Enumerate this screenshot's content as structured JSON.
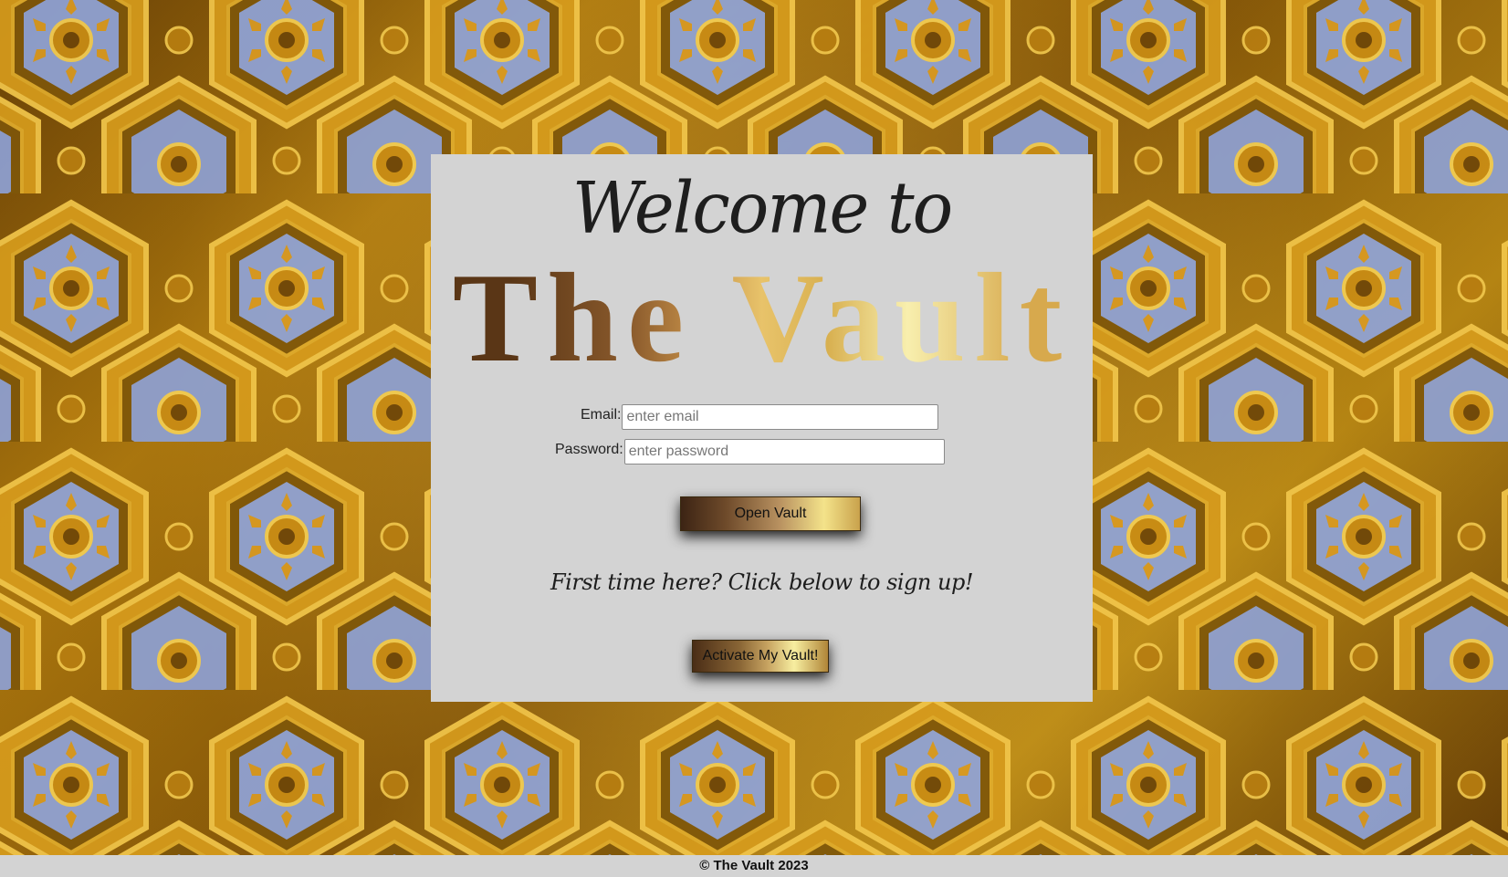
{
  "background": {
    "icon": "ornate-gold-ceiling-pattern",
    "colors": {
      "gold": "#c8941a",
      "dark_gold": "#6b4306",
      "blue": "#8fa3d8"
    }
  },
  "panel": {
    "background_color": "#d3d3d3",
    "welcome_text": "Welcome to",
    "title": "The Vault"
  },
  "login_form": {
    "email_label": "Email:",
    "email_placeholder": "enter email",
    "email_value": "",
    "password_label": "Password:",
    "password_placeholder": "enter password",
    "password_value": "",
    "submit_label": "Open Vault"
  },
  "signup": {
    "prompt": "First time here? Click below to sign up!",
    "button_label": "Activate My Vault!"
  },
  "footer": {
    "text": "© The Vault 2023"
  }
}
